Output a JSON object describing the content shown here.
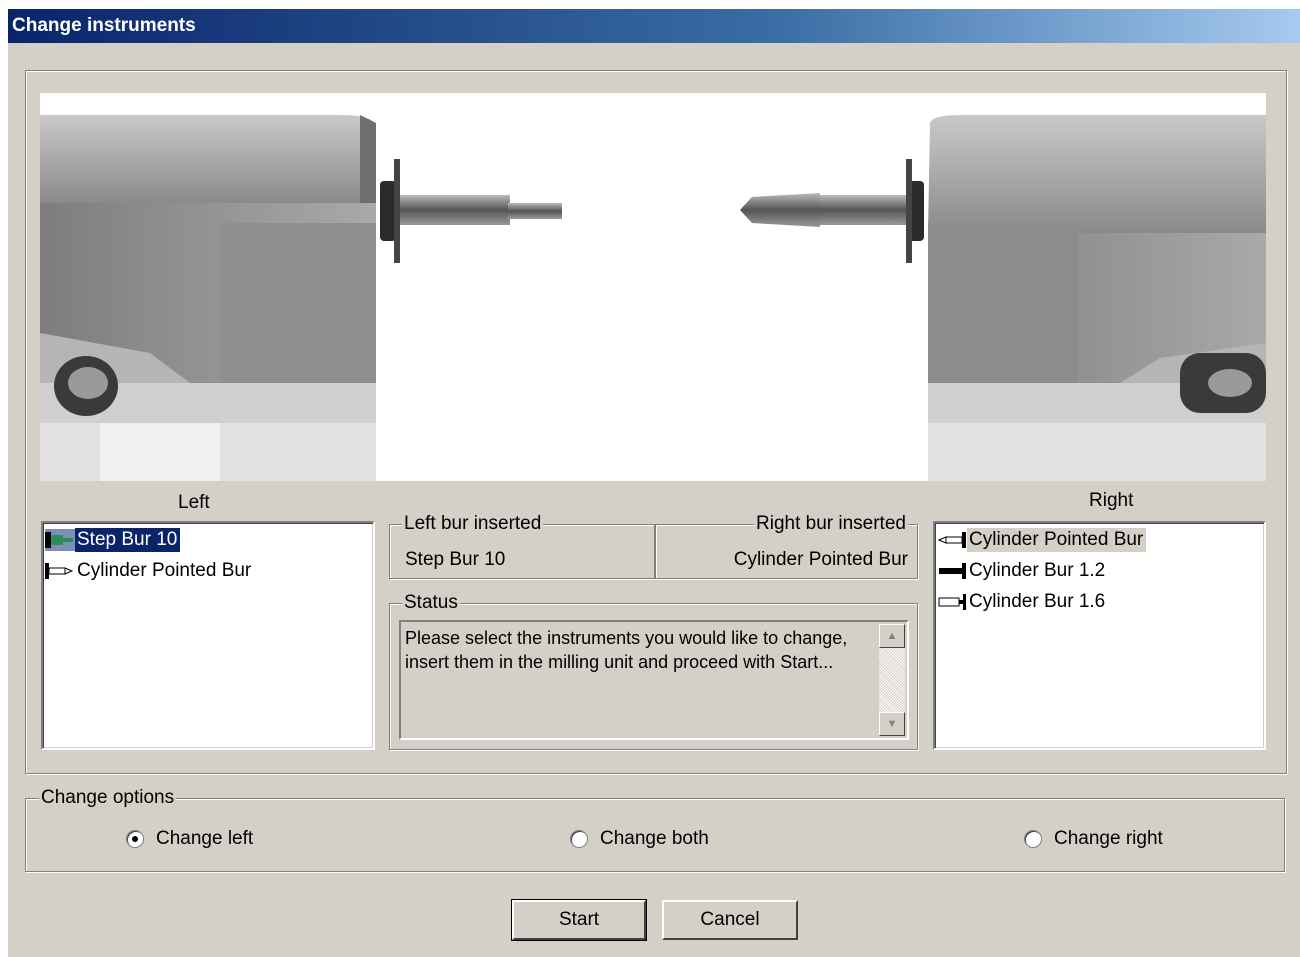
{
  "window": {
    "title": "Change instruments"
  },
  "left": {
    "label": "Left",
    "items": [
      {
        "name": "Step Bur 10",
        "icon": "step-bur-icon",
        "selected": true
      },
      {
        "name": "Cylinder Pointed Bur",
        "icon": "cylinder-pointed-bur-icon"
      }
    ]
  },
  "right": {
    "label": "Right",
    "items": [
      {
        "name": "Cylinder Pointed Bur",
        "icon": "cylinder-pointed-bur-icon",
        "selected": true
      },
      {
        "name": "Cylinder Bur 1.2",
        "icon": "cylinder-bur-icon"
      },
      {
        "name": "Cylinder Bur 1.6",
        "icon": "cylinder-bur-icon"
      }
    ]
  },
  "inserted": {
    "left_title": "Left bur inserted",
    "left_value": "Step Bur 10",
    "right_title": "Right bur inserted",
    "right_value": "Cylinder Pointed Bur"
  },
  "status": {
    "title": "Status",
    "text": "Please select the instruments you would like to change, insert them in the milling unit and proceed with Start..."
  },
  "options": {
    "title": "Change options",
    "change_left": "Change left",
    "change_both": "Change both",
    "change_right": "Change right",
    "selected": "change_left"
  },
  "buttons": {
    "start": "Start",
    "cancel": "Cancel"
  }
}
